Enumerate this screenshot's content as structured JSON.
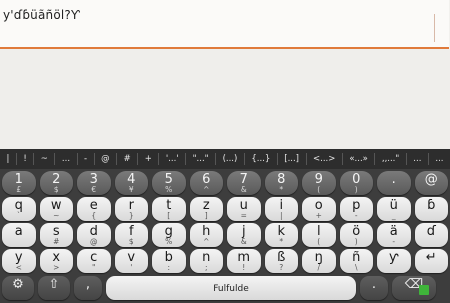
{
  "editor": {
    "text": "y'ɗɓüãñöl?Ƴ"
  },
  "keyboard": {
    "symbols": [
      "|",
      "!",
      "~",
      "...",
      "-",
      "@",
      "#",
      "+",
      "'...'",
      "\"...\"",
      "(...)",
      "{...}",
      "[...]",
      "<...>",
      "«...»",
      ",,...\"",
      "...",
      "..."
    ],
    "num_row": [
      {
        "main": "1",
        "sub": "£"
      },
      {
        "main": "2",
        "sub": "$"
      },
      {
        "main": "3",
        "sub": "€"
      },
      {
        "main": "4",
        "sub": "¥"
      },
      {
        "main": "5",
        "sub": "%"
      },
      {
        "main": "6",
        "sub": "^"
      },
      {
        "main": "7",
        "sub": "&"
      },
      {
        "main": "8",
        "sub": "*"
      },
      {
        "main": "9",
        "sub": "("
      },
      {
        "main": "0",
        "sub": ")"
      },
      {
        "main": ".",
        "sub": ""
      },
      {
        "main": "@",
        "sub": ""
      }
    ],
    "row1": [
      {
        "main": "q",
        "sub": "`"
      },
      {
        "main": "w",
        "sub": "~"
      },
      {
        "main": "e",
        "sub": "{"
      },
      {
        "main": "r",
        "sub": "}"
      },
      {
        "main": "t",
        "sub": "["
      },
      {
        "main": "z",
        "sub": "]"
      },
      {
        "main": "u",
        "sub": "="
      },
      {
        "main": "i",
        "sub": "|"
      },
      {
        "main": "o",
        "sub": "+"
      },
      {
        "main": "p",
        "sub": "-"
      },
      {
        "main": "ü",
        "sub": "_"
      },
      {
        "main": "ɓ",
        "sub": ""
      }
    ],
    "row2": [
      {
        "main": "a",
        "sub": ""
      },
      {
        "main": "s",
        "sub": "#"
      },
      {
        "main": "d",
        "sub": "@"
      },
      {
        "main": "f",
        "sub": "$"
      },
      {
        "main": "g",
        "sub": "%"
      },
      {
        "main": "h",
        "sub": "^"
      },
      {
        "main": "j",
        "sub": "&"
      },
      {
        "main": "k",
        "sub": "*"
      },
      {
        "main": "l",
        "sub": "("
      },
      {
        "main": "ö",
        "sub": ")"
      },
      {
        "main": "ä",
        "sub": "-"
      },
      {
        "main": "ɗ",
        "sub": ""
      }
    ],
    "row3": [
      {
        "main": "y",
        "sub": "<"
      },
      {
        "main": "x",
        "sub": ">"
      },
      {
        "main": "c",
        "sub": "\""
      },
      {
        "main": "v",
        "sub": "'"
      },
      {
        "main": "b",
        "sub": ":"
      },
      {
        "main": "n",
        "sub": ";"
      },
      {
        "main": "m",
        "sub": "!"
      },
      {
        "main": "ß",
        "sub": "?"
      },
      {
        "main": "ŋ",
        "sub": "/"
      },
      {
        "main": "ñ",
        "sub": "\\"
      },
      {
        "main": "ƴ",
        "sub": ""
      },
      {
        "main": "↵",
        "sub": ""
      }
    ],
    "bottom": {
      "settings_icon": "⚙",
      "shift_icon": "⇧",
      "comma": ",",
      "space_label": "Fulfulde",
      "period": ".",
      "backspace_icon": "⌫"
    }
  }
}
